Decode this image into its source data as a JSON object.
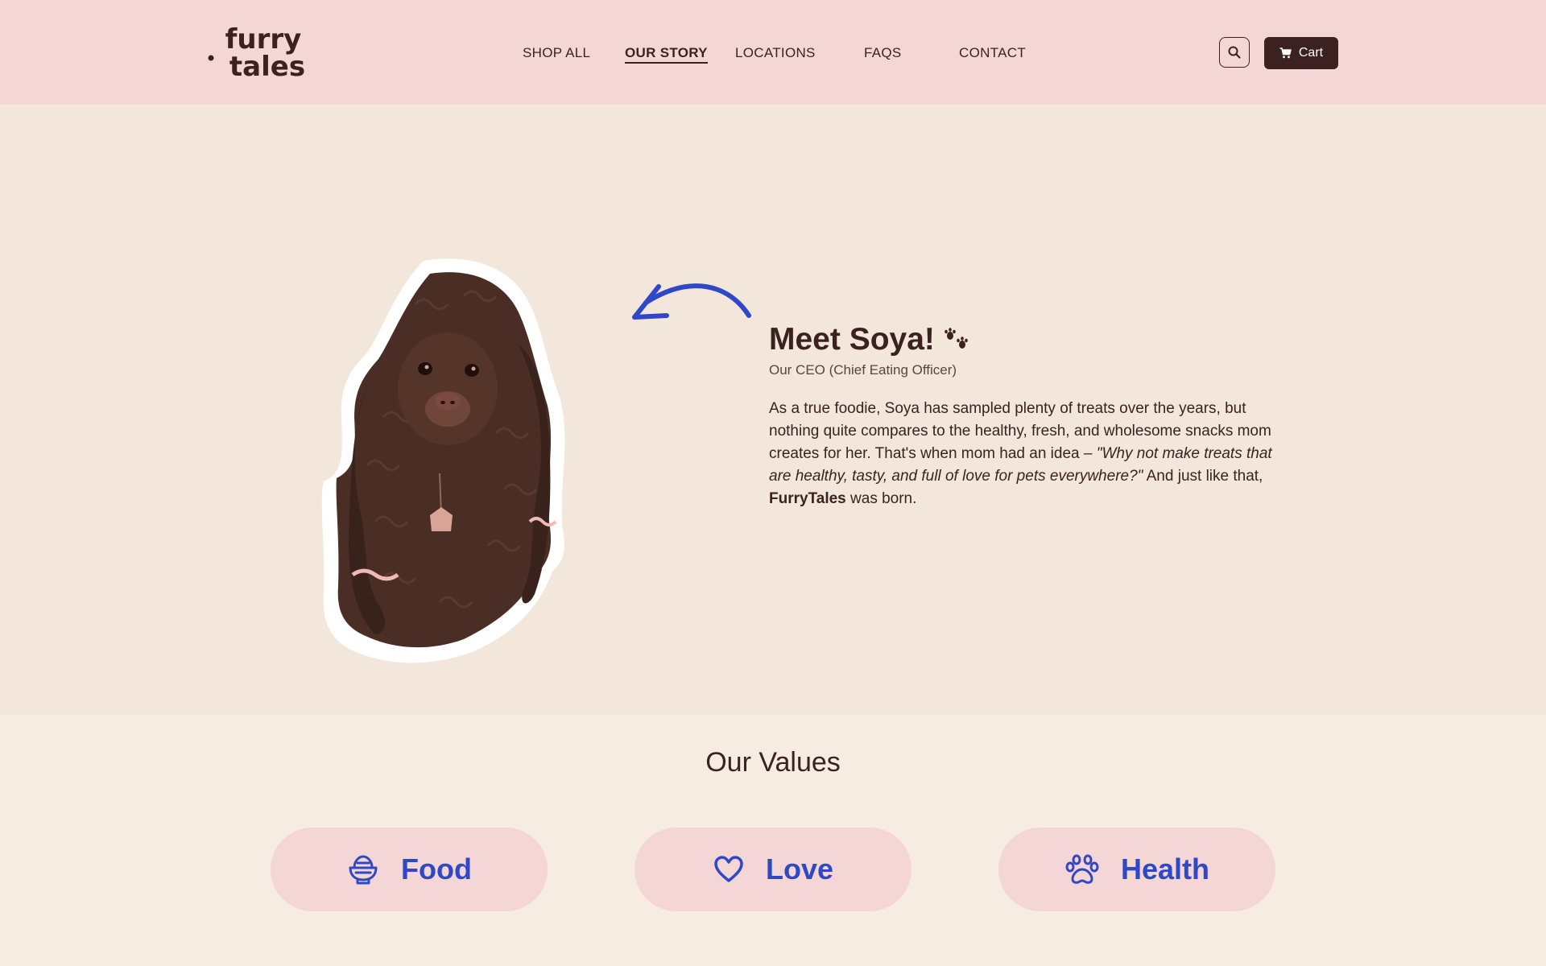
{
  "brand": {
    "logo_line1": "furry",
    "logo_line2": "tales"
  },
  "nav": {
    "items": [
      {
        "label": "SHOP ALL",
        "active": false
      },
      {
        "label": "OUR STORY",
        "active": true
      },
      {
        "label": "LOCATIONS",
        "active": false
      },
      {
        "label": "FAQS",
        "active": false
      },
      {
        "label": "CONTACT",
        "active": false
      }
    ],
    "search_icon": "search-icon",
    "cart_label": "Cart",
    "cart_icon": "cart-icon"
  },
  "hero": {
    "title": "Meet Soya!",
    "title_icon": "paw-prints-icon",
    "subtitle": "Our CEO (Chief Eating Officer)",
    "story_part1": "As a true foodie, Soya has sampled plenty of treats over the years, but nothing quite compares to the healthy, fresh, and wholesome snacks mom creates for her. That's when mom had an idea – ",
    "story_quote": "\"Why not make treats that are healthy, tasty, and full of love for pets everywhere?\"",
    "story_part2": " And just like that, ",
    "story_brand": "FurryTales",
    "story_part3": " was born."
  },
  "values": {
    "title": "Our Values",
    "items": [
      {
        "label": "Food",
        "icon": "food-bowl-icon"
      },
      {
        "label": "Love",
        "icon": "heart-icon"
      },
      {
        "label": "Health",
        "icon": "paw-icon"
      }
    ]
  },
  "colors": {
    "header_bg": "#f5d6d6",
    "hero_bg": "#f2e7da",
    "values_bg": "#f6ece2",
    "brown": "#3b2220",
    "accent_blue": "#2f47c9",
    "pill_bg": "#f5d6d6"
  }
}
